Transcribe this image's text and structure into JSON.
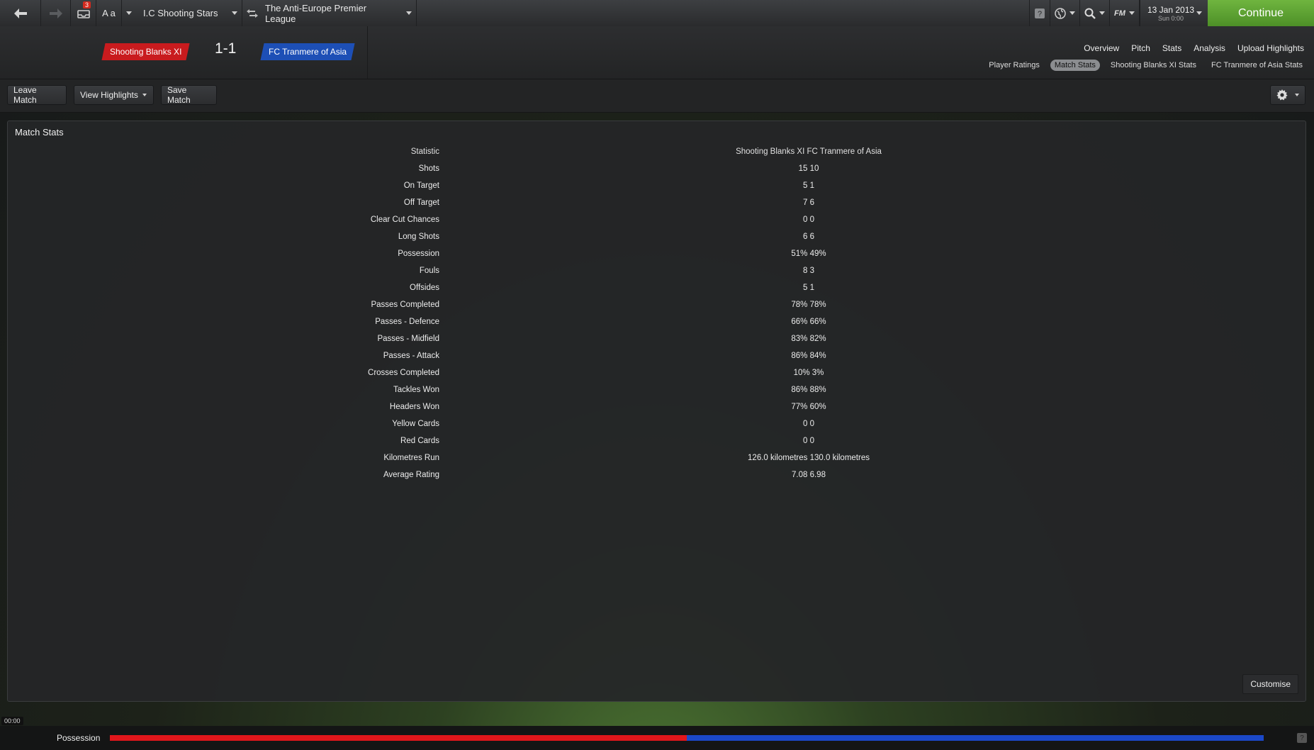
{
  "topbar": {
    "back_icon": "arrow-left-icon",
    "forward_icon": "arrow-right-icon",
    "inbox_badge": "3",
    "font_size_label": "A a",
    "club_name": "I.C Shooting Stars",
    "competition_name": "The Anti-Europe Premier League",
    "date": "13 Jan 2013",
    "time": "Sun 0:00",
    "fm_label": "FM",
    "continue_label": "Continue"
  },
  "match": {
    "home_team": "Shooting Blanks XI",
    "away_team": "FC Tranmere of Asia",
    "score": "1-1",
    "home_color": "#c91b1e",
    "away_color": "#1d4fb6"
  },
  "nav": {
    "main": [
      "Overview",
      "Pitch",
      "Stats",
      "Analysis",
      "Upload Highlights"
    ],
    "sub": [
      "Player Ratings",
      "Match Stats",
      "Shooting Blanks XI Stats",
      "FC Tranmere of Asia Stats"
    ],
    "sub_active": "Match Stats"
  },
  "actions": {
    "leave": "Leave Match",
    "highlights": "View Highlights",
    "save": "Save Match"
  },
  "panel": {
    "title": "Match Stats",
    "header_label": "Statistic",
    "header_value": "Shooting Blanks XI FC Tranmere of Asia",
    "rows": [
      {
        "label": "Shots",
        "value": "15 10"
      },
      {
        "label": "On Target",
        "value": "5 1"
      },
      {
        "label": "Off Target",
        "value": "7 6"
      },
      {
        "label": "Clear Cut Chances",
        "value": "0 0"
      },
      {
        "label": "Long Shots",
        "value": "6 6"
      },
      {
        "label": "Possession",
        "value": "51% 49%"
      },
      {
        "label": "Fouls",
        "value": "8 3"
      },
      {
        "label": "Offsides",
        "value": "5 1"
      },
      {
        "label": "Passes Completed",
        "value": "78% 78%"
      },
      {
        "label": "Passes - Defence",
        "value": "66% 66%"
      },
      {
        "label": "Passes - Midfield",
        "value": "83% 82%"
      },
      {
        "label": "Passes - Attack",
        "value": "86% 84%"
      },
      {
        "label": "Crosses Completed",
        "value": "10% 3%"
      },
      {
        "label": "Tackles Won",
        "value": "86% 88%"
      },
      {
        "label": "Headers Won",
        "value": "77% 60%"
      },
      {
        "label": "Yellow Cards",
        "value": "0 0"
      },
      {
        "label": "Red Cards",
        "value": "0 0"
      },
      {
        "label": "Kilometres Run",
        "value": "126.0 kilometres 130.0 kilometres"
      },
      {
        "label": "Average Rating",
        "value": "7.08 6.98"
      }
    ],
    "customise_label": "Customise"
  },
  "bottom": {
    "timer": "00:00",
    "possession_label": "Possession",
    "home_possession": 0.5,
    "help_label": "?"
  }
}
